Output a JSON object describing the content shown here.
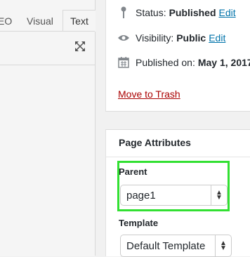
{
  "editor": {
    "tabs": [
      {
        "label": "EO"
      },
      {
        "label": "Visual"
      },
      {
        "label": "Text"
      }
    ],
    "fullscreen_icon": "fullscreen-icon"
  },
  "publish": {
    "status_label": "Status:",
    "status_value": "Published",
    "status_edit": "Edit",
    "visibility_label": "Visibility:",
    "visibility_value": "Public",
    "visibility_edit": "Edit",
    "published_label": "Published on:",
    "published_value": "May 1, 2017",
    "trash_link": "Move to Trash",
    "icons": {
      "status": "pin-icon",
      "visibility": "eye-icon",
      "published": "calendar-icon"
    }
  },
  "attributes": {
    "title": "Page Attributes",
    "parent_label": "Parent",
    "parent_value": "page1",
    "template_label": "Template",
    "template_value": "Default Template"
  },
  "colors": {
    "highlight": "#32e032",
    "link": "#0073aa",
    "trash": "#aa0000"
  }
}
